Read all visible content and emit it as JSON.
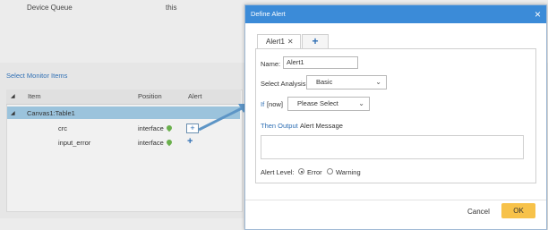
{
  "background": {
    "device_queue_label": "Device Queue",
    "device_queue_value": "this",
    "section_title": "Select Monitor Items",
    "table": {
      "columns": [
        "Item",
        "Position",
        "Alert"
      ],
      "group_row": "Canvas1:Table1",
      "rows": [
        {
          "item": "crc",
          "position": "interface"
        },
        {
          "item": "input_error",
          "position": "interface"
        }
      ]
    }
  },
  "dialog": {
    "title": "Define Alert",
    "tabs": [
      {
        "label": "Alert1"
      }
    ],
    "form": {
      "name_label": "Name:",
      "name_value": "Alert1",
      "analysis_label": "Select Analysis",
      "analysis_value": "Basic",
      "if_label": "If",
      "now_label": "[now]",
      "condition_value": "Please Select",
      "then_label": "Then Output",
      "alert_message_label": "Alert Message",
      "level_label": "Alert Level:",
      "level_options": [
        "Error",
        "Warning"
      ],
      "level_selected": "Error"
    },
    "buttons": {
      "cancel": "Cancel",
      "ok": "OK"
    }
  },
  "colors": {
    "title_bar": "#3b8bd8",
    "ok_button": "#f7c24a",
    "group_row": "#9bc3dc",
    "link_blue": "#2f6fb4"
  }
}
